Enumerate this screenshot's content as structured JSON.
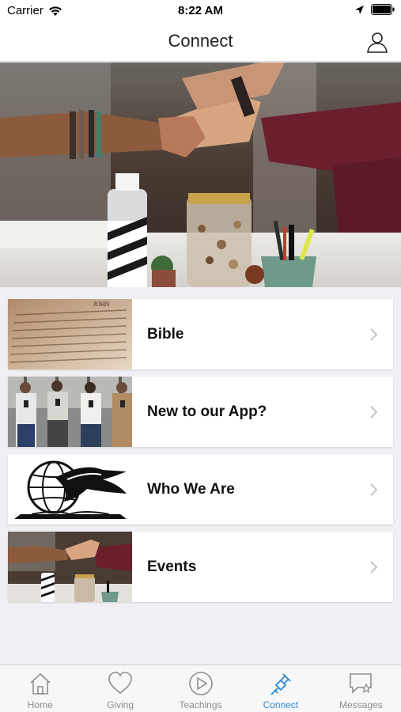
{
  "status_bar": {
    "carrier": "Carrier",
    "time": "8:22 AM"
  },
  "nav": {
    "title": "Connect"
  },
  "cards": [
    {
      "label": "Bible"
    },
    {
      "label": "New to our App?"
    },
    {
      "label": "Who We Are"
    },
    {
      "label": "Events"
    }
  ],
  "bible_thumb_text": {
    "heading": "JOHN"
  },
  "tabs": [
    {
      "label": "Home"
    },
    {
      "label": "Giving"
    },
    {
      "label": "Teachings"
    },
    {
      "label": "Connect"
    },
    {
      "label": "Messages"
    }
  ],
  "colors": {
    "accent": "#2d8bd8",
    "inactive": "#8e8e93"
  },
  "icons": {
    "status": [
      "wifi-icon",
      "location-arrow-icon",
      "battery-icon"
    ],
    "nav": "profile-icon",
    "tabs": [
      "home-icon",
      "heart-icon",
      "play-circle-icon",
      "plug-icon",
      "chat-star-icon"
    ]
  }
}
